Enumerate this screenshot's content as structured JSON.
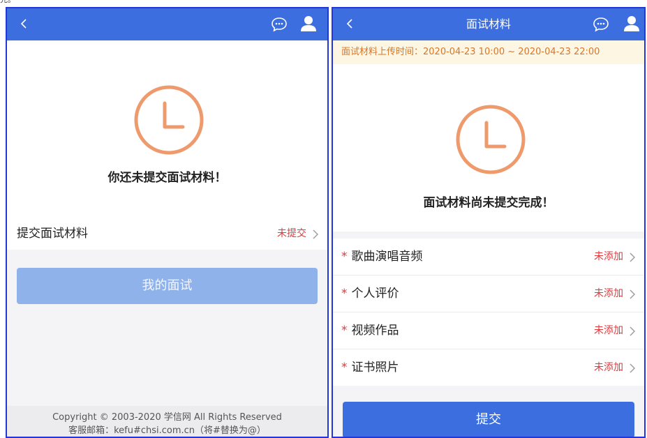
{
  "corner_fragment": "先。",
  "left": {
    "message": "你还未提交面试材料！",
    "row": {
      "label": "提交面试材料",
      "status": "未提交"
    },
    "button_label": "我的面试",
    "footer": {
      "line1": "Copyright © 2003-2020 学信网 All Rights Reserved",
      "line2": "客服邮箱：kefu#chsi.com.cn（将#替换为@）"
    }
  },
  "right": {
    "title": "面试材料",
    "notice": "面试材料上传时间：2020-04-23 10:00 ~ 2020-04-23 22:00",
    "message": "面试材料尚未提交完成！",
    "items": [
      {
        "label": "歌曲演唱音频",
        "status": "未添加"
      },
      {
        "label": "个人评价",
        "status": "未添加"
      },
      {
        "label": "视频作品",
        "status": "未添加"
      },
      {
        "label": "证书照片",
        "status": "未添加"
      }
    ],
    "required_mark": "*",
    "submit_label": "提交"
  },
  "colors": {
    "header_blue": "#3d6ee0",
    "alert_red": "#e0393c",
    "clock_orange": "#ee9a6c",
    "notice_bg": "#fdf6e3",
    "notice_text": "#d9762a",
    "disabled_button": "#8fb2ea"
  },
  "icons": [
    "back-arrow-icon",
    "chat-bubble-icon",
    "user-icon",
    "clock-icon",
    "chevron-right-icon"
  ]
}
